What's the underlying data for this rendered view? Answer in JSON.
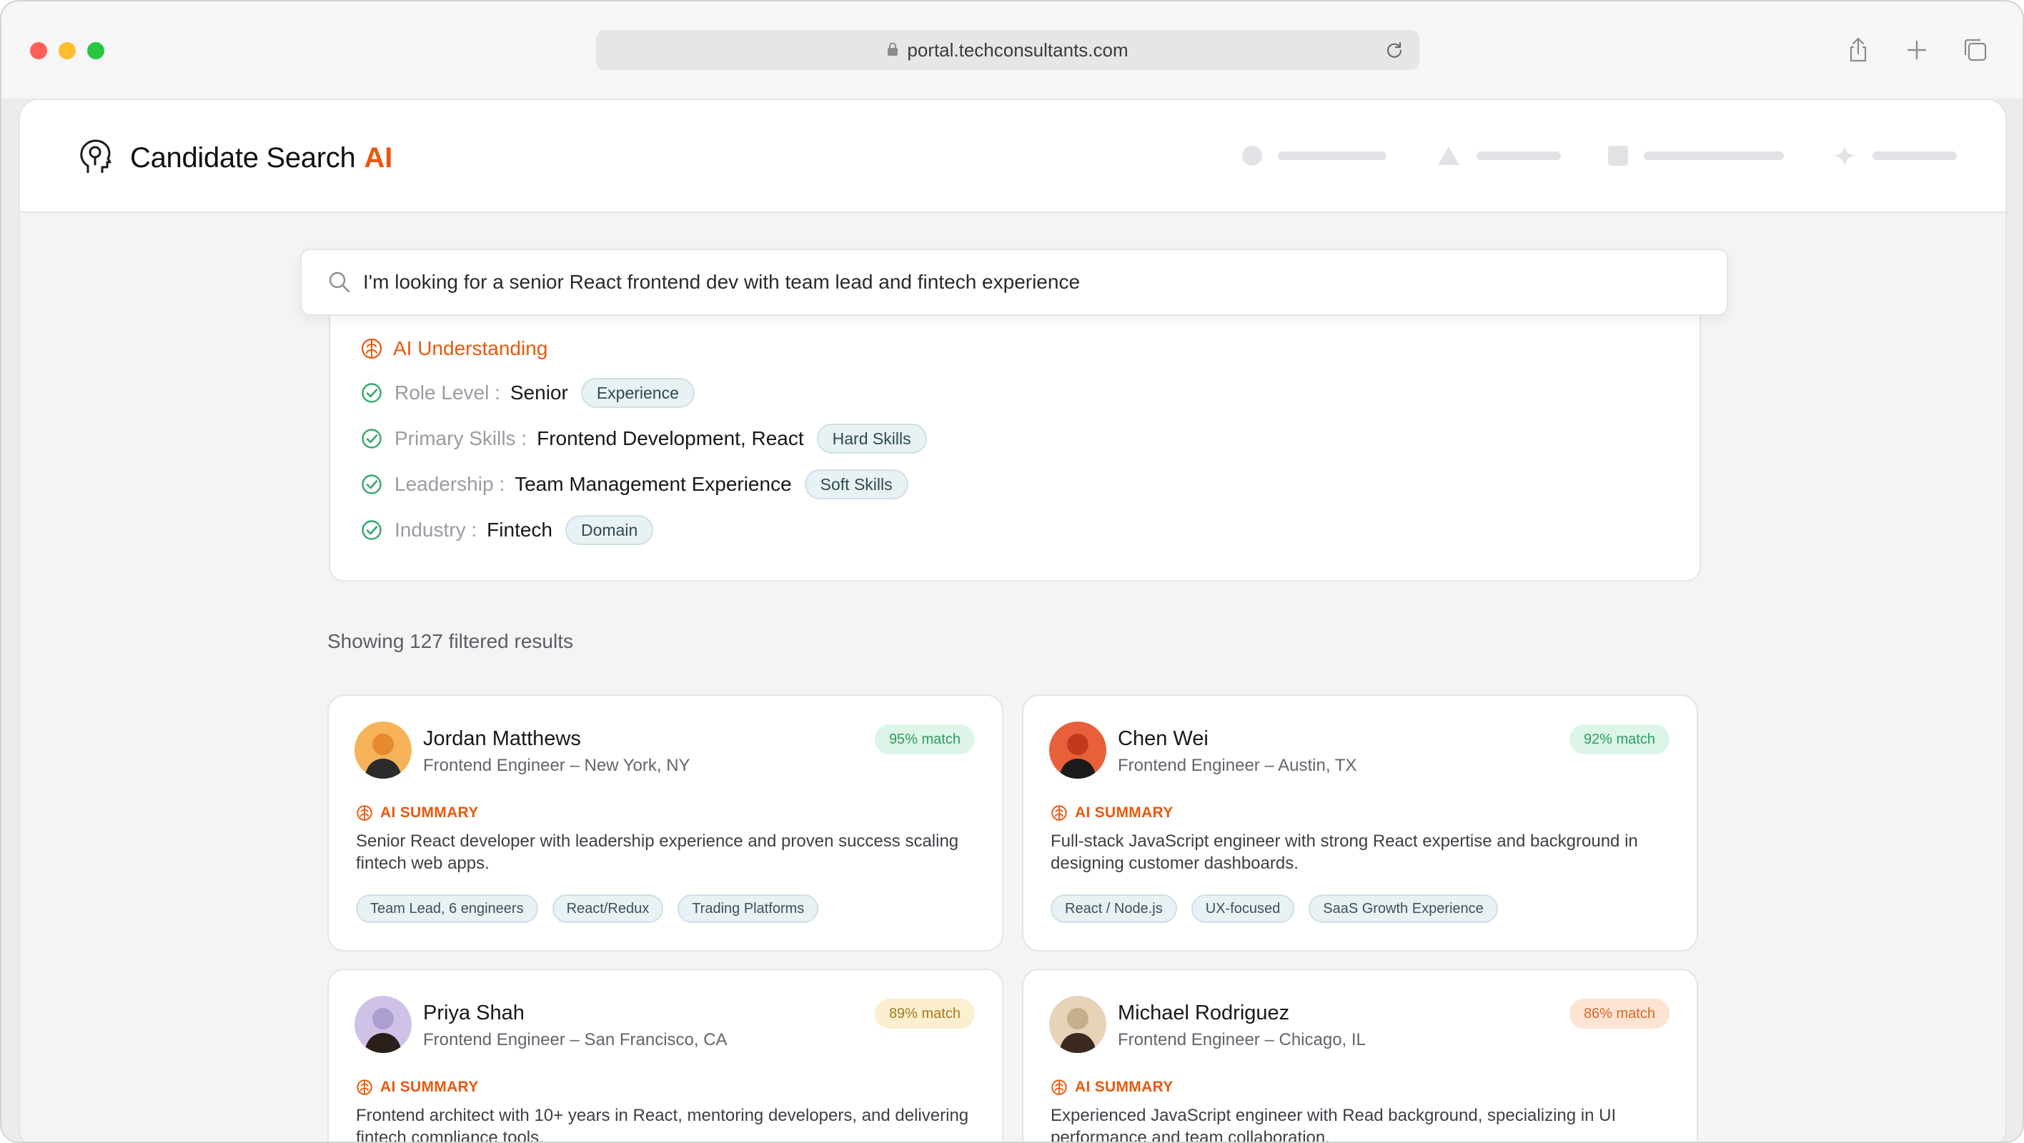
{
  "browser": {
    "url": "portal.techconsultants.com"
  },
  "app": {
    "title": "Candidate Search",
    "title_accent": "AI",
    "accent_color": "#ea580c"
  },
  "search": {
    "query": "I'm looking for a senior React frontend dev with team lead and fintech experience"
  },
  "understanding": {
    "title": "AI Understanding",
    "rows": [
      {
        "key": "Role Level :",
        "value": "Senior",
        "tag": "Experience"
      },
      {
        "key": "Primary Skills :",
        "value": "Frontend Development, React",
        "tag": "Hard Skills"
      },
      {
        "key": "Leadership :",
        "value": "Team Management Experience",
        "tag": "Soft Skills"
      },
      {
        "key": "Industry :",
        "value": "Fintech",
        "tag": "Domain"
      }
    ]
  },
  "results": {
    "count_text": "Showing 127 filtered results",
    "ai_summary_label": "AI SUMMARY",
    "candidates": [
      {
        "name": "Jordan Matthews",
        "role": "Frontend Engineer – New York, NY",
        "match": "95% match",
        "summary": "Senior React developer with leadership experience and proven success scaling fintech web apps.",
        "tags": [
          "Team Lead, 6 engineers",
          "React/Redux",
          "Trading Platforms"
        ]
      },
      {
        "name": "Chen Wei",
        "role": "Frontend Engineer – Austin, TX",
        "match": "92% match",
        "summary": "Full-stack JavaScript engineer with strong React expertise and background in designing customer dashboards.",
        "tags": [
          "React / Node.js",
          "UX-focused",
          "SaaS Growth Experience"
        ]
      },
      {
        "name": "Priya Shah",
        "role": "Frontend Engineer – San Francisco, CA",
        "match": "89% match",
        "summary": "Frontend architect with 10+ years in React, mentoring developers, and delivering fintech compliance tools."
      },
      {
        "name": "Michael Rodriguez",
        "role": "Frontend Engineer – Chicago, IL",
        "match": "86% match",
        "summary": "Experienced JavaScript engineer with Read background, specializing in UI performance and team collaboration."
      }
    ]
  }
}
